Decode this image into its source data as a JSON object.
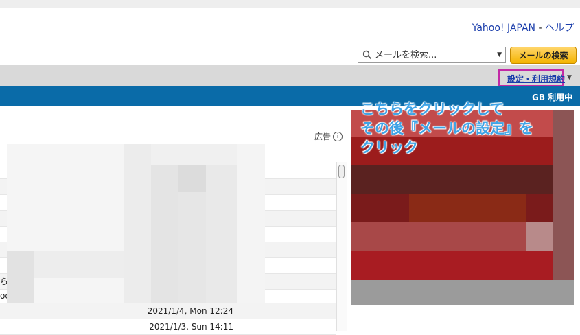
{
  "header": {
    "yahoo_link": "Yahoo! JAPAN",
    "separator": "-",
    "help_link": "ヘルプ"
  },
  "search": {
    "placeholder": "メールを検索...",
    "button": "メールの検索"
  },
  "nav": {
    "settings_link": "設定・利用規約"
  },
  "storage": {
    "usage": "GB 利用中"
  },
  "ad": {
    "label": "広告",
    "info_icon": "i"
  },
  "annotation": {
    "line1": "こちらをクリックして",
    "line2": "その後『メールの設定』を",
    "line3": "クリック"
  },
  "message_list": {
    "dates": [
      "2021/1/4, Mon 12:24",
      "2021/1/3, Sun 14:11"
    ],
    "left_fragments": [
      "ら",
      "oc"
    ]
  }
}
